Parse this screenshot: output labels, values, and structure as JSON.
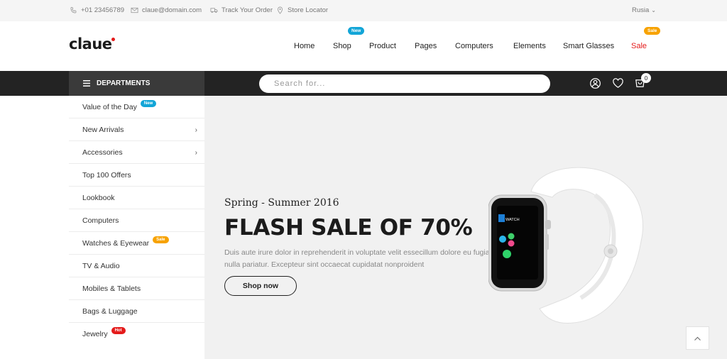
{
  "topbar": {
    "phone": "+01 23456789",
    "email": "claue@domain.com",
    "track": "Track Your Order",
    "store": "Store Locator",
    "language": "Rusia"
  },
  "header": {
    "logo": "claue",
    "nav": [
      {
        "label": "Home"
      },
      {
        "label": "Shop",
        "badge": "New"
      },
      {
        "label": "Product"
      },
      {
        "label": "Pages"
      },
      {
        "label": "Computers"
      },
      {
        "label": "Elements"
      },
      {
        "label": "Smart Glasses"
      },
      {
        "label": "Sale",
        "badge": "Sale"
      }
    ]
  },
  "bar": {
    "departments": "DEPARTMENTS",
    "search_placeholder": "Search for...",
    "cart_count": "0"
  },
  "sidebar": {
    "items": [
      {
        "label": "Value of the Day",
        "badge": "New"
      },
      {
        "label": "New Arrivals",
        "chevron": "›"
      },
      {
        "label": "Accessories",
        "chevron": "›"
      },
      {
        "label": "Top 100 Offers"
      },
      {
        "label": "Lookbook"
      },
      {
        "label": "Computers"
      },
      {
        "label": "Watches & Eyewear",
        "badge": "Sale"
      },
      {
        "label": "TV & Audio"
      },
      {
        "label": "Mobiles & Tablets"
      },
      {
        "label": "Bags & Luggage"
      },
      {
        "label": "Jewelry",
        "badge": "Hot"
      }
    ]
  },
  "hero": {
    "subtitle": "Spring - Summer 2016",
    "title": "FLASH SALE OF 70%",
    "description": "Duis aute irure dolor in reprehenderit in voluptate velit essecillum dolore eu fugiat nulla pariatur. Excepteur sint occaecat cupidatat nonproident",
    "button": "Shop now",
    "watch_screen_label": "WATCH"
  },
  "colors": {
    "accent_red": "#e41b1b",
    "badge_blue": "#12a5d7",
    "badge_orange": "#f7a200",
    "dark_bar": "#232323"
  }
}
